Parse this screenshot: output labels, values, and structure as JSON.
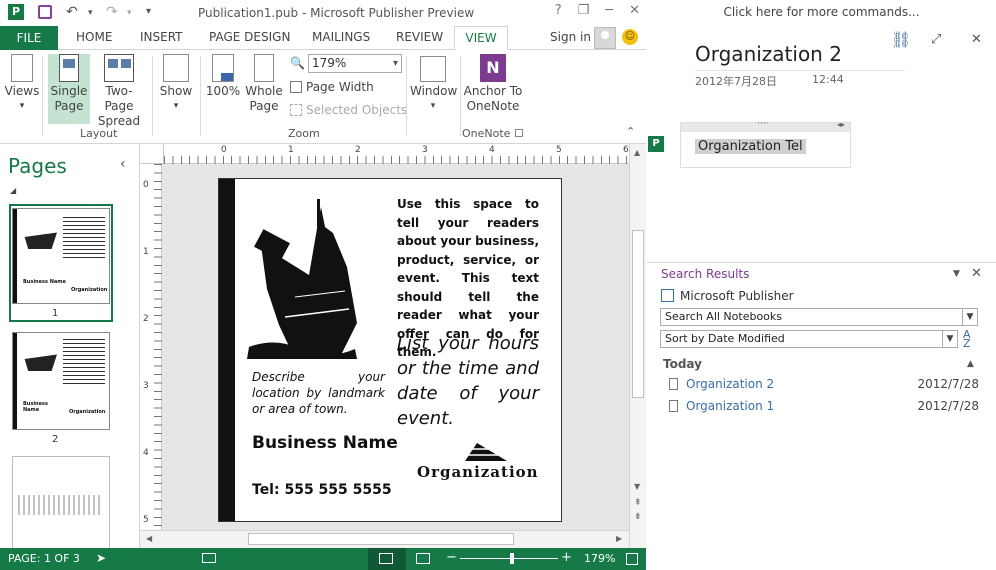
{
  "window": {
    "title": "Publication1.pub - Microsoft Publisher Preview",
    "help": "?",
    "restore": "❐",
    "minimize": "─",
    "close": "✕"
  },
  "tabs": {
    "file": "FILE",
    "home": "HOME",
    "insert": "INSERT",
    "page_design": "PAGE DESIGN",
    "mailings": "MAILINGS",
    "review": "REVIEW",
    "view": "VIEW"
  },
  "account": {
    "signin": "Sign in"
  },
  "ribbon": {
    "views": "Views",
    "single_page_1": "Single",
    "single_page_2": "Page",
    "two_page_1": "Two-Page",
    "two_page_2": "Spread",
    "show": "Show",
    "zoom100": "100%",
    "whole_page_1": "Whole",
    "whole_page_2": "Page",
    "zoom_value": "179%",
    "page_width": "Page Width",
    "selected_objects": "Selected Objects",
    "window": "Window",
    "anchor_1": "Anchor To",
    "anchor_2": "OneNote",
    "group_layout": "Layout",
    "group_zoom": "Zoom",
    "group_onenote": "OneNote"
  },
  "pages_pane": {
    "title": "Pages",
    "collapse": "‹",
    "items": [
      {
        "num": "1",
        "selected": true
      },
      {
        "num": "2",
        "selected": false
      },
      {
        "num": "",
        "selected": false
      }
    ]
  },
  "rulers": {
    "h": [
      "0",
      "1",
      "2",
      "3",
      "4",
      "5",
      "6"
    ],
    "v": [
      "0",
      "1",
      "2",
      "3",
      "4",
      "5"
    ]
  },
  "publication": {
    "body": "Use this space to tell your readers about your business, product, service, or event. This text should tell the reader what your offer can do for them.",
    "hours": "List your hours or the time and date of your event.",
    "describe": "Describe your location by landmark or area of town.",
    "business": "Business Name",
    "org": "Organization",
    "tel": "Tel: 555 555 5555",
    "thumb_business": "Business Name",
    "thumb_business_2a": "Business",
    "thumb_business_2b": "Name",
    "thumb_org": "Organization"
  },
  "status": {
    "page": "PAGE: 1 OF 3",
    "zoom": "179%"
  },
  "onenote": {
    "top_bar": "Click here for more commands...",
    "title": "Organization 2",
    "date": "2012年7月28日",
    "time": "12:44",
    "note_text": "Organization Tel",
    "search": {
      "title": "Search Results",
      "source": "Microsoft Publisher",
      "scope": "Search All Notebooks",
      "sort": "Sort by Date Modified",
      "group": "Today",
      "results": [
        {
          "name": "Organization 2",
          "date": "2012/7/28"
        },
        {
          "name": "Organization 1",
          "date": "2012/7/28"
        }
      ]
    }
  }
}
